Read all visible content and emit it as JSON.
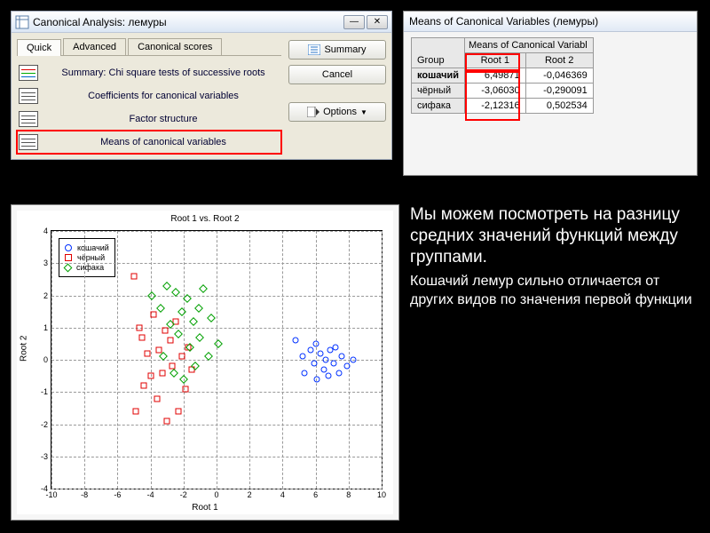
{
  "dialog": {
    "title": "Canonical Analysis: лемуры",
    "tabs": [
      "Quick",
      "Advanced",
      "Canonical scores"
    ],
    "items": [
      "Summary:  Chi square tests of successive roots",
      "Coefficients for canonical variables",
      "Factor structure",
      "Means of canonical variables"
    ],
    "buttons": {
      "summary": "Summary",
      "cancel": "Cancel",
      "options": "Options"
    }
  },
  "table": {
    "title": "Means of Canonical Variables (лемуры)",
    "mega": "Means of Canonical Variabl",
    "group_hdr": "Group",
    "cols": [
      "Root 1",
      "Root 2"
    ],
    "rows": [
      {
        "g": "кошачий",
        "v": [
          "6,49871",
          "-0,046369"
        ]
      },
      {
        "g": "чёрный",
        "v": [
          "-3,06030",
          "-0,290091"
        ]
      },
      {
        "g": "сифака",
        "v": [
          "-2,12316",
          "0,502534"
        ]
      }
    ]
  },
  "chart_data": {
    "type": "scatter",
    "title": "Root 1 vs. Root 2",
    "xlabel": "Root 1",
    "ylabel": "Root 2",
    "xlim": [
      -10,
      10
    ],
    "ylim": [
      -4,
      4
    ],
    "xticks": [
      -10,
      -8,
      -6,
      -4,
      -2,
      0,
      2,
      4,
      6,
      8,
      10
    ],
    "yticks": [
      -4,
      -3,
      -2,
      -1,
      0,
      1,
      2,
      3,
      4
    ],
    "series": [
      {
        "name": "кошачий",
        "marker": "circle-blue",
        "points": [
          [
            4.8,
            0.6
          ],
          [
            5.2,
            0.1
          ],
          [
            5.3,
            -0.4
          ],
          [
            5.7,
            0.3
          ],
          [
            5.9,
            -0.1
          ],
          [
            6.0,
            0.5
          ],
          [
            6.1,
            -0.6
          ],
          [
            6.3,
            0.2
          ],
          [
            6.5,
            -0.3
          ],
          [
            6.6,
            0.0
          ],
          [
            6.8,
            -0.5
          ],
          [
            6.9,
            0.3
          ],
          [
            7.1,
            -0.1
          ],
          [
            7.2,
            0.4
          ],
          [
            7.4,
            -0.4
          ],
          [
            7.6,
            0.1
          ],
          [
            7.9,
            -0.2
          ],
          [
            8.3,
            0.0
          ]
        ]
      },
      {
        "name": "чёрный",
        "marker": "square-red",
        "points": [
          [
            -5.0,
            2.6
          ],
          [
            -4.9,
            -1.6
          ],
          [
            -4.7,
            1.0
          ],
          [
            -4.5,
            0.7
          ],
          [
            -4.4,
            -0.8
          ],
          [
            -4.2,
            0.2
          ],
          [
            -4.0,
            -0.5
          ],
          [
            -3.8,
            1.4
          ],
          [
            -3.6,
            -1.2
          ],
          [
            -3.5,
            0.3
          ],
          [
            -3.3,
            -0.4
          ],
          [
            -3.1,
            0.9
          ],
          [
            -3.0,
            -1.9
          ],
          [
            -2.8,
            0.6
          ],
          [
            -2.7,
            -0.2
          ],
          [
            -2.5,
            1.2
          ],
          [
            -2.3,
            -1.6
          ],
          [
            -2.1,
            0.1
          ],
          [
            -1.9,
            -0.9
          ],
          [
            -1.7,
            0.4
          ],
          [
            -1.5,
            -0.3
          ]
        ]
      },
      {
        "name": "сифака",
        "marker": "diamond-green",
        "points": [
          [
            -3.9,
            2.0
          ],
          [
            -3.4,
            1.6
          ],
          [
            -3.2,
            0.1
          ],
          [
            -3.0,
            2.3
          ],
          [
            -2.8,
            1.1
          ],
          [
            -2.6,
            -0.4
          ],
          [
            -2.5,
            2.1
          ],
          [
            -2.3,
            0.8
          ],
          [
            -2.1,
            1.5
          ],
          [
            -2.0,
            -0.6
          ],
          [
            -1.8,
            1.9
          ],
          [
            -1.6,
            0.4
          ],
          [
            -1.4,
            1.2
          ],
          [
            -1.3,
            -0.2
          ],
          [
            -1.1,
            1.6
          ],
          [
            -1.0,
            0.7
          ],
          [
            -0.8,
            2.2
          ],
          [
            -0.5,
            0.1
          ],
          [
            -0.3,
            1.3
          ],
          [
            0.1,
            0.5
          ]
        ]
      }
    ]
  },
  "text": {
    "p1": "Мы можем  посмотреть на разницу средних значений функций между группами.",
    "p2": "Кошачий лемур сильно отличается от других видов по значения первой функции"
  }
}
